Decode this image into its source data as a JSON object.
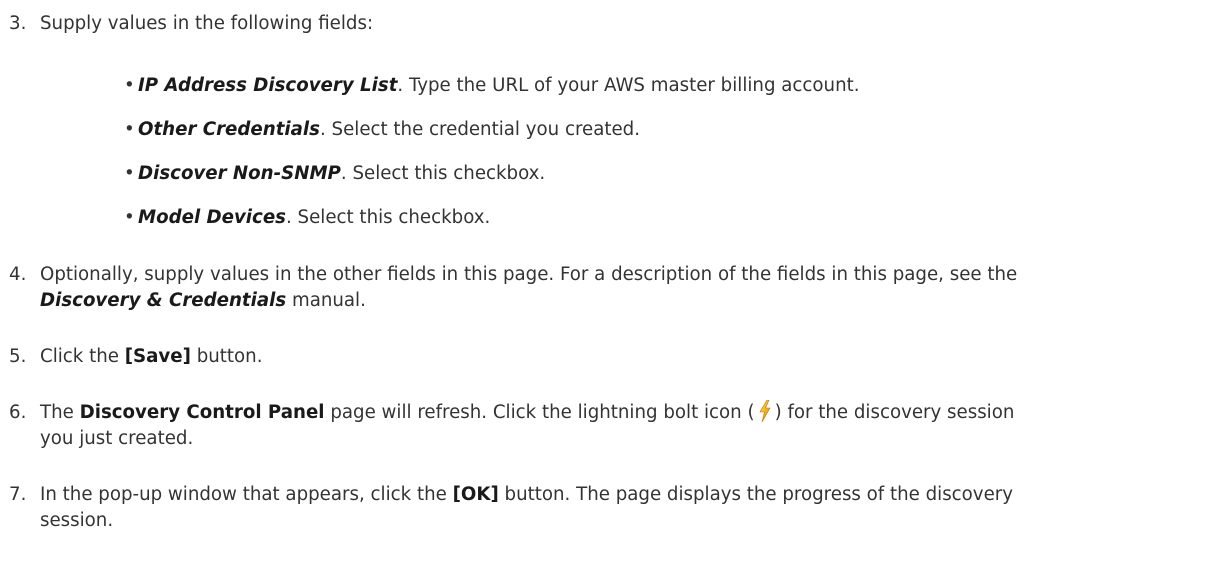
{
  "step3": {
    "number": "3.",
    "text": "Supply values in the following fields:"
  },
  "bullets": [
    {
      "field": "IP Address Discovery List",
      "rest": ". Type the URL of your AWS master billing account."
    },
    {
      "field": "Other Credentials",
      "rest": ". Select the credential you created."
    },
    {
      "field": "Discover Non-SNMP",
      "rest": ". Select this checkbox."
    },
    {
      "field": "Model Devices",
      "rest": ". Select this checkbox."
    }
  ],
  "step4": {
    "number": "4.",
    "line1": "Optionally, supply values in the other fields in this page. For a description of the fields in this page, see the",
    "manual_name": "Discovery & Credentials",
    "manual_suffix": " manual."
  },
  "step5": {
    "number": "5.",
    "prefix": "Click the ",
    "button_label": "[Save]",
    "suffix": " button."
  },
  "step6": {
    "number": "6.",
    "prefix": "The ",
    "page_name": "Discovery Control Panel",
    "middle": " page will refresh. Click the lightning bolt icon (",
    "after_icon": ") for the discovery session",
    "line2": "you just created.",
    "icon": "lightning-bolt-icon"
  },
  "step7": {
    "number": "7.",
    "prefix": "In the pop-up window that appears, click the ",
    "button_label": "[OK]",
    "suffix": " button. The page displays the progress of the discovery",
    "line2": "session."
  }
}
